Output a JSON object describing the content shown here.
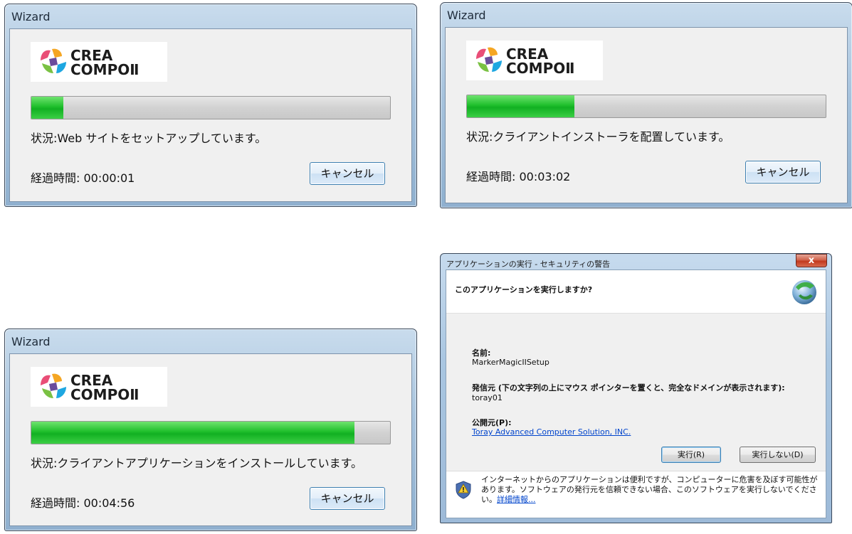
{
  "wizards": [
    {
      "title": "Wizard",
      "logo_line1": "CREA",
      "logo_line2": "COMPOⅡ",
      "progress_fraction": 0.09,
      "status_label": "状況:",
      "status_text": "Web サイトをセットアップしています。",
      "elapsed_label": "経過時間:",
      "elapsed_value": "00:00:01",
      "cancel_label": "キャンセル"
    },
    {
      "title": "Wizard",
      "logo_line1": "CREA",
      "logo_line2": "COMPOⅡ",
      "progress_fraction": 0.3,
      "status_label": "状況:",
      "status_text": "クライアントインストーラを配置しています。",
      "elapsed_label": "経過時間:",
      "elapsed_value": "00:03:02",
      "cancel_label": "キャンセル"
    },
    {
      "title": "Wizard",
      "logo_line1": "CREA",
      "logo_line2": "COMPOⅡ",
      "progress_fraction": 0.9,
      "status_label": "状況:",
      "status_text": "クライアントアプリケーションをインストールしています。",
      "elapsed_label": "経過時間:",
      "elapsed_value": "00:04:56",
      "cancel_label": "キャンセル"
    }
  ],
  "security_dialog": {
    "title": "アプリケーションの実行 - セキュリティの警告",
    "close_glyph": "x",
    "question": "このアプリケーションを実行しますか?",
    "name_label": "名前:",
    "name_value": "MarkerMagicIISetup",
    "from_label": "発信元 (下の文字列の上にマウス ポインターを置くと、完全なドメインが表示されます):",
    "from_value": "toray01",
    "publisher_label": "公開元(P):",
    "publisher_value": "Toray Advanced Computer Solution, INC.",
    "run_button": "実行(R)",
    "dont_run_button": "実行しない(D)",
    "warning_text": "インターネットからのアプリケーションは便利ですが、コンピューターに危害を及ぼす可能性があります。ソフトウェアの発行元を信頼できない場合、このソフトウェアを実行しないでください。",
    "more_info_link": "詳細情報..."
  }
}
